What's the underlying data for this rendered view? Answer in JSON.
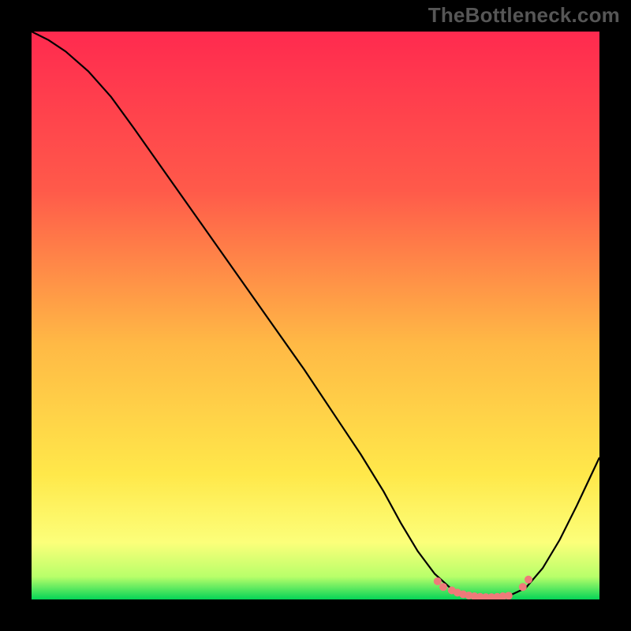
{
  "watermark": {
    "text": "TheBottleneck.com"
  },
  "chart_data": {
    "type": "line",
    "title": "",
    "xlabel": "",
    "ylabel": "",
    "xlim": [
      0,
      100
    ],
    "ylim": [
      0,
      100
    ],
    "grid": false,
    "legend": false,
    "background_gradient": {
      "stops": [
        {
          "offset": 0,
          "color": "#ff2a4f"
        },
        {
          "offset": 28,
          "color": "#ff5a4a"
        },
        {
          "offset": 55,
          "color": "#ffb945"
        },
        {
          "offset": 78,
          "color": "#ffe84a"
        },
        {
          "offset": 90,
          "color": "#fcff7a"
        },
        {
          "offset": 96,
          "color": "#b8ff6a"
        },
        {
          "offset": 100,
          "color": "#05d457"
        }
      ]
    },
    "series": [
      {
        "name": "main-curve",
        "color": "#000000",
        "x": [
          0,
          3,
          6,
          10,
          14,
          18,
          24,
          30,
          36,
          42,
          48,
          54,
          58,
          62,
          65,
          68,
          71,
          74,
          77,
          80,
          82,
          84,
          87,
          90,
          93,
          96,
          100
        ],
        "y": [
          100,
          98.5,
          96.5,
          93,
          88.5,
          83,
          74.5,
          66,
          57.5,
          49,
          40.5,
          31.5,
          25.5,
          19,
          13.5,
          8.5,
          4.5,
          1.8,
          0.6,
          0.4,
          0.4,
          0.6,
          2.0,
          5.5,
          10.5,
          16.5,
          25
        ]
      }
    ],
    "highlight_points": {
      "name": "near-minimum-band",
      "color": "#ef7a7a",
      "radius": 5,
      "points": [
        {
          "x": 71.5,
          "y": 3.2
        },
        {
          "x": 72.5,
          "y": 2.2
        },
        {
          "x": 74.0,
          "y": 1.6
        },
        {
          "x": 75.0,
          "y": 1.2
        },
        {
          "x": 76.0,
          "y": 0.9
        },
        {
          "x": 77.0,
          "y": 0.7
        },
        {
          "x": 78.0,
          "y": 0.55
        },
        {
          "x": 79.0,
          "y": 0.45
        },
        {
          "x": 80.0,
          "y": 0.4
        },
        {
          "x": 81.0,
          "y": 0.4
        },
        {
          "x": 82.0,
          "y": 0.45
        },
        {
          "x": 83.0,
          "y": 0.55
        },
        {
          "x": 84.0,
          "y": 0.65
        },
        {
          "x": 86.5,
          "y": 2.2
        },
        {
          "x": 87.5,
          "y": 3.5
        }
      ]
    }
  }
}
